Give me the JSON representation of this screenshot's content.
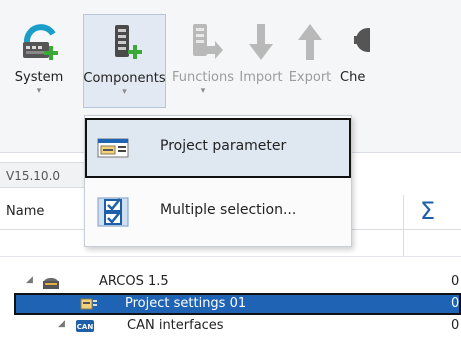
{
  "ribbon": {
    "buttons": [
      {
        "label": "System",
        "icon": "system-icon",
        "has_caret": true,
        "state": "normal"
      },
      {
        "label": "Components",
        "icon": "components-icon",
        "has_caret": true,
        "state": "active"
      },
      {
        "label": "Functions",
        "icon": "functions-icon",
        "has_caret": true,
        "state": "disabled"
      },
      {
        "label": "Import",
        "icon": "import-icon",
        "has_caret": false,
        "state": "disabled"
      },
      {
        "label": "Export",
        "icon": "export-icon",
        "has_caret": false,
        "state": "disabled"
      },
      {
        "label": "Che",
        "icon": "check-icon",
        "has_caret": false,
        "state": "normal"
      }
    ],
    "caret": "▾"
  },
  "components_menu": {
    "items": [
      {
        "label": "Project parameter",
        "icon": "project-parameter-icon",
        "highlighted": true
      },
      {
        "label": "Multiple selection...",
        "icon": "multiple-selection-icon",
        "highlighted": false
      }
    ]
  },
  "panel": {
    "version": "V15.10.0",
    "column_name": "Name",
    "sum_symbol": "Σ"
  },
  "tree": [
    {
      "label": "ARCOS 1.5",
      "icon": "ecu-icon",
      "expand": "◢",
      "value": "0",
      "selected": false
    },
    {
      "label": "Project settings 01",
      "icon": "project-settings-icon",
      "expand": "",
      "value": "0",
      "selected": true
    },
    {
      "label": "CAN interfaces",
      "icon": "can-icon",
      "icon_text": "CAN",
      "expand": "◢",
      "value": "0",
      "selected": false
    }
  ],
  "colors": {
    "accent": "#1f63b5",
    "green_plus": "#3aa935",
    "sum": "#1f5fa8"
  }
}
